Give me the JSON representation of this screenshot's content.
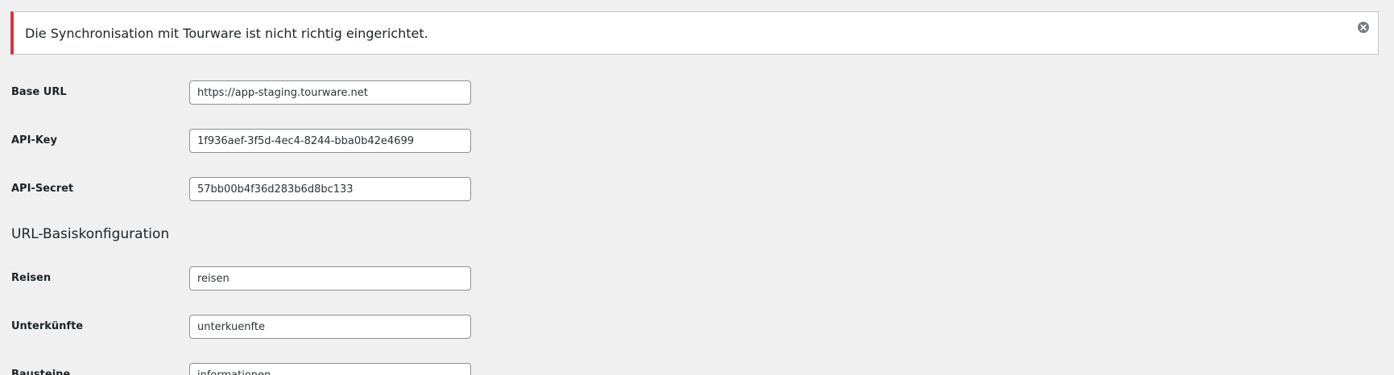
{
  "notice": {
    "message": "Die Synchronisation mit Tourware ist nicht richtig eingerichtet.",
    "dismiss_icon": "close-circle-icon",
    "accent_color": "#d63638"
  },
  "connection": {
    "base_url": {
      "label": "Base URL",
      "value": "https://app-staging.tourware.net"
    },
    "api_key": {
      "label": "API-Key",
      "value": "1f936aef-3f5d-4ec4-8244-bba0b42e4699"
    },
    "api_secret": {
      "label": "API-Secret",
      "value": "57bb00b4f36d283b6d8bc133"
    }
  },
  "url_config": {
    "title": "URL-Basiskonfiguration",
    "reisen": {
      "label": "Reisen",
      "value": "reisen"
    },
    "unterkuenfte": {
      "label": "Unterkünfte",
      "value": "unterkuenfte"
    },
    "bausteine": {
      "label": "Bausteine",
      "value": "informationen"
    }
  }
}
